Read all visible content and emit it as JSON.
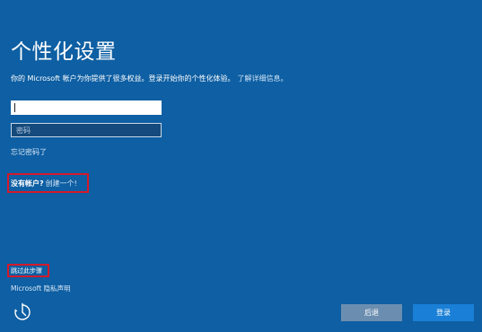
{
  "page": {
    "title": "个性化设置",
    "subtitle": "你的 Microsoft 帐户为你提供了很多权益。登录开始你的个性化体验。",
    "learn_more": "了解详细信息。"
  },
  "form": {
    "account_value": "",
    "password_placeholder": "密码",
    "forgot_password": "忘记密码了"
  },
  "signup": {
    "question": "没有帐户?",
    "create_link": "创建一个!"
  },
  "footer": {
    "skip_step": "跳过此步骤",
    "privacy": "Microsoft 隐私声明",
    "ease_of_access_icon": "ease-of-access-icon"
  },
  "buttons": {
    "back": "后退",
    "sign_in": "登录"
  },
  "colors": {
    "background": "#0e5fa3",
    "highlight": "#d31a2c",
    "primary_button": "#1a7fd6",
    "secondary_button": "#6b8eb0"
  }
}
